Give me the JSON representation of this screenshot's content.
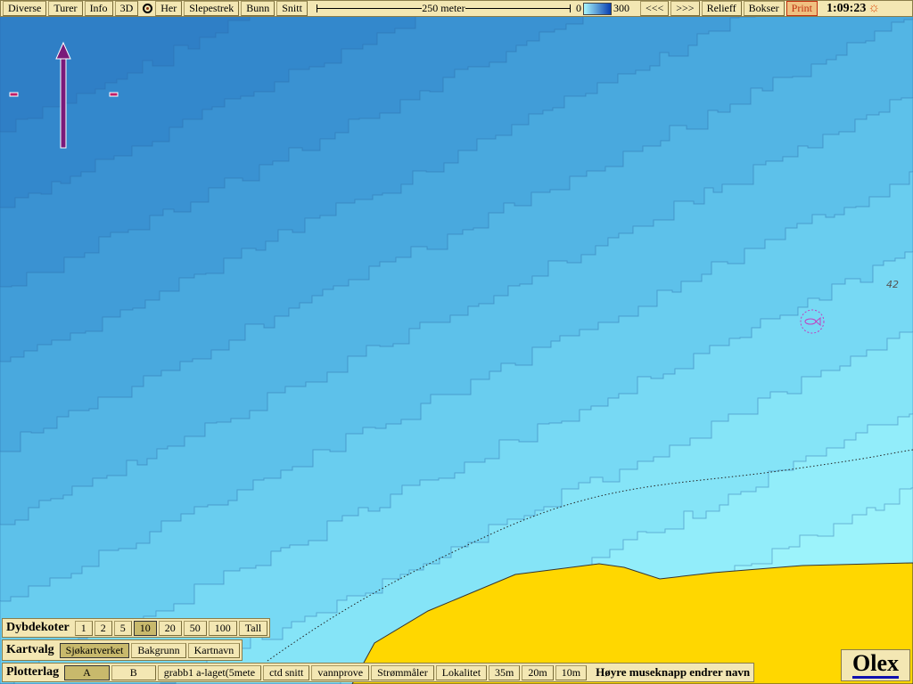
{
  "toolbar": {
    "buttons": [
      "Diverse",
      "Turer",
      "Info",
      "3D",
      "Her",
      "Slepestrek",
      "Bunn",
      "Snitt"
    ],
    "scale_label": "250 meter",
    "legend_min": "0",
    "legend_max": "300",
    "prev": "<<<",
    "next": ">>>",
    "relieff": "Relieff",
    "bokser": "Bokser",
    "print": "Print",
    "clock": "1:09:23"
  },
  "map": {
    "depth_label": "42",
    "land_color": "#ffd700",
    "deep_color": "#2f7fc6",
    "shallow_color": "#a6f8fc"
  },
  "dybdekoter": {
    "label": "Dybdekoter",
    "options": [
      "1",
      "2",
      "5",
      "10",
      "20",
      "50",
      "100",
      "Tall"
    ],
    "selected": "10"
  },
  "kartvalg": {
    "label": "Kartvalg",
    "options": [
      "Sjøkartverket",
      "Bakgrunn",
      "Kartnavn"
    ],
    "selected": "Sjøkartverket"
  },
  "plotterlag": {
    "label": "Plotterlag",
    "options": [
      "A",
      "B",
      "grabb1 a-laget(5mete",
      "ctd snitt",
      "vannprove",
      "Strømmåler",
      "Lokalitet",
      "35m",
      "20m",
      "10m"
    ],
    "selected": "A",
    "hint": "Høyre museknapp endrer navn"
  },
  "logo": "Olex"
}
